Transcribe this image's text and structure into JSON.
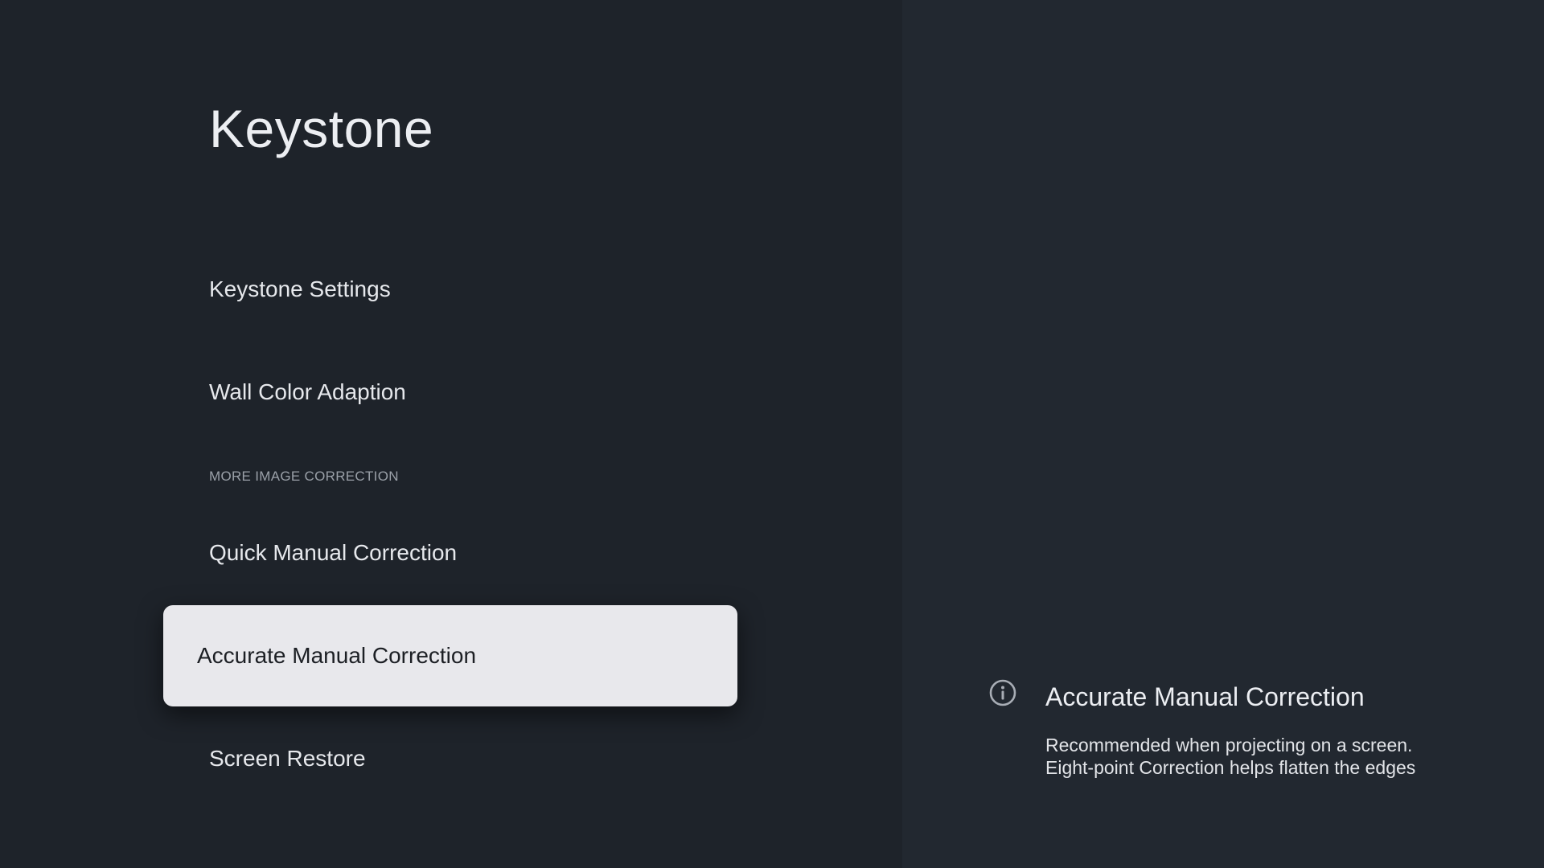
{
  "page": {
    "title": "Keystone"
  },
  "menu": {
    "items": [
      {
        "label": "Keystone Settings"
      },
      {
        "label": "Wall Color Adaption"
      }
    ],
    "section_header": "MORE IMAGE CORRECTION",
    "section_items": [
      {
        "label": "Quick Manual Correction",
        "selected": false
      },
      {
        "label": "Accurate Manual Correction",
        "selected": true
      },
      {
        "label": "Screen Restore",
        "selected": false
      }
    ]
  },
  "info": {
    "icon": "info-icon",
    "title": "Accurate Manual Correction",
    "description_lines": [
      "Recommended when projecting on a screen.",
      "Eight-point Correction helps flatten the edges"
    ]
  },
  "colors": {
    "background_left": "#1e232a",
    "background_right": "#222830",
    "selected_item_bg": "#e8e8ec",
    "text_primary": "#eceef2",
    "text_secondary": "#9aa0a8"
  }
}
